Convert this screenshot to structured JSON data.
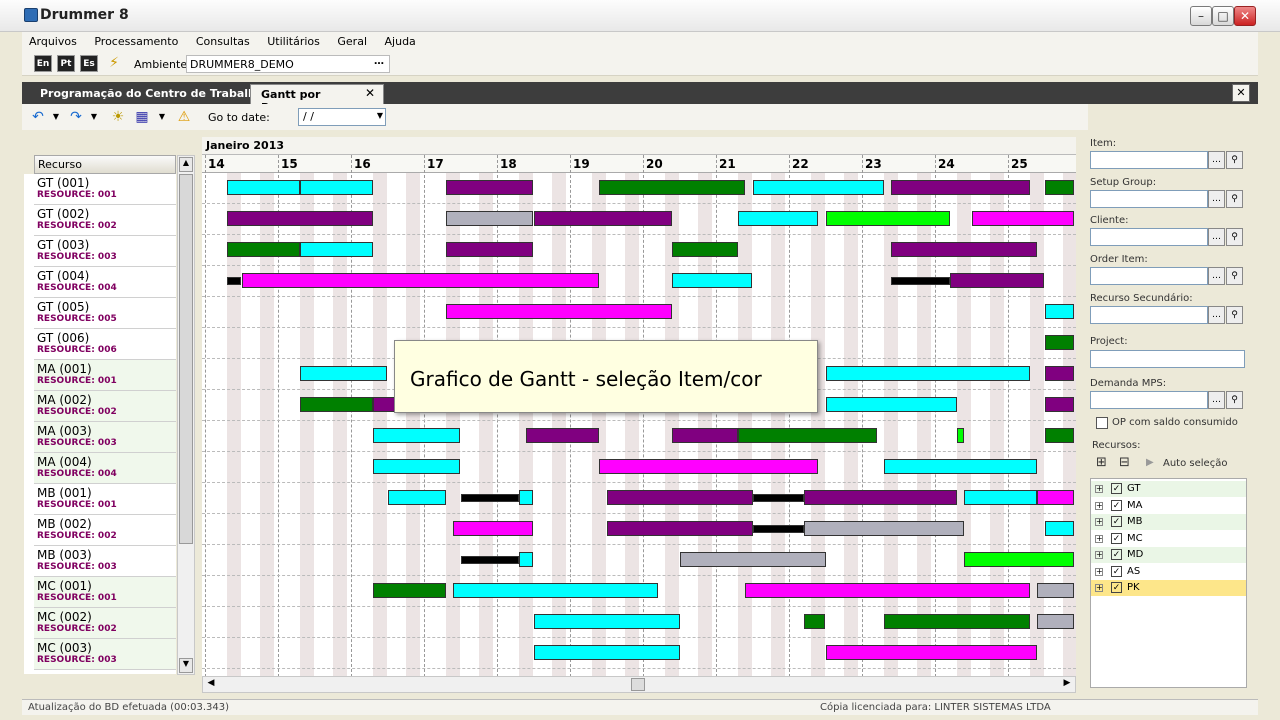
{
  "window": {
    "title": "Drummer 8"
  },
  "menu": [
    "Arquivos",
    "Processamento",
    "Consultas",
    "Utilitários",
    "Geral",
    "Ajuda"
  ],
  "toolbar": {
    "lang": [
      "En",
      "Pt",
      "Es"
    ],
    "ambiente_label": "Ambiente:",
    "ambiente_value": "DRUMMER8_DEMO"
  },
  "tabs": [
    {
      "label": "Programação do Centro de Trabalho"
    },
    {
      "label": "Gantt por Recurso"
    }
  ],
  "gantt_toolbar": {
    "goto_label": "Go to date:",
    "goto_value": "/ /"
  },
  "resources_header": "Recurso",
  "resources": [
    {
      "name": "GT (001)",
      "sub": "RESOURCE: 001"
    },
    {
      "name": "GT (002)",
      "sub": "RESOURCE: 002"
    },
    {
      "name": "GT (003)",
      "sub": "RESOURCE: 003"
    },
    {
      "name": "GT (004)",
      "sub": "RESOURCE: 004"
    },
    {
      "name": "GT (005)",
      "sub": "RESOURCE: 005"
    },
    {
      "name": "GT (006)",
      "sub": "RESOURCE: 006"
    },
    {
      "name": "MA (001)",
      "sub": "RESOURCE: 001"
    },
    {
      "name": "MA (002)",
      "sub": "RESOURCE: 002"
    },
    {
      "name": "MA (003)",
      "sub": "RESOURCE: 003"
    },
    {
      "name": "MA (004)",
      "sub": "RESOURCE: 004"
    },
    {
      "name": "MB (001)",
      "sub": "RESOURCE: 001"
    },
    {
      "name": "MB (002)",
      "sub": "RESOURCE: 002"
    },
    {
      "name": "MB (003)",
      "sub": "RESOURCE: 003"
    },
    {
      "name": "MC (001)",
      "sub": "RESOURCE: 001"
    },
    {
      "name": "MC (002)",
      "sub": "RESOURCE: 002"
    },
    {
      "name": "MC (003)",
      "sub": "RESOURCE: 003"
    }
  ],
  "gantt": {
    "month": "Janeiro 2013",
    "days": [
      "14",
      "15",
      "16",
      "17",
      "18",
      "19",
      "20",
      "21",
      "22",
      "23",
      "24",
      "25"
    ]
  },
  "colors": {
    "cyan": "#00ffff",
    "purple": "#800080",
    "green": "#008000",
    "magenta": "#ff00ff",
    "gray": "#b0b0bc",
    "lime": "#00ff00",
    "black": "#000000"
  },
  "tasks": [
    [
      [
        14.3,
        15.3,
        "cyan"
      ],
      [
        15.3,
        16.3,
        "cyan"
      ],
      [
        17.3,
        18.5,
        "purple"
      ],
      [
        19.4,
        21.4,
        "green"
      ],
      [
        21.5,
        23.3,
        "cyan"
      ],
      [
        23.4,
        25.3,
        "purple"
      ],
      [
        25.5,
        26,
        "green"
      ]
    ],
    [
      [
        14.3,
        16.3,
        "purple"
      ],
      [
        17.3,
        18.5,
        "gray"
      ],
      [
        18.5,
        20.4,
        "purple"
      ],
      [
        21.3,
        22.4,
        "cyan"
      ],
      [
        22.5,
        24.2,
        "lime"
      ],
      [
        24.5,
        26,
        "magenta"
      ]
    ],
    [
      [
        14.3,
        15.3,
        "green"
      ],
      [
        15.3,
        16.3,
        "cyan"
      ],
      [
        17.3,
        18.5,
        "purple"
      ],
      [
        20.4,
        21.3,
        "green"
      ],
      [
        23.4,
        25.4,
        "purple"
      ]
    ],
    [
      [
        14.3,
        14.5,
        "black"
      ],
      [
        14.5,
        19.4,
        "magenta"
      ],
      [
        20.4,
        21.5,
        "cyan"
      ],
      [
        23.4,
        24.2,
        "black"
      ],
      [
        24.2,
        25.5,
        "purple"
      ]
    ],
    [
      [
        17.3,
        20.4,
        "magenta"
      ],
      [
        25.5,
        26,
        "cyan"
      ]
    ],
    [
      [
        25.5,
        26,
        "green"
      ]
    ],
    [
      [
        15.3,
        16.5,
        "cyan"
      ],
      [
        22.5,
        25.3,
        "cyan"
      ],
      [
        25.5,
        26,
        "purple"
      ]
    ],
    [
      [
        15.3,
        16.3,
        "green"
      ],
      [
        16.3,
        17.3,
        "purple"
      ],
      [
        22.5,
        24.3,
        "cyan"
      ],
      [
        25.5,
        26,
        "purple"
      ]
    ],
    [
      [
        16.3,
        17.5,
        "cyan"
      ],
      [
        18.4,
        19.4,
        "purple"
      ],
      [
        20.4,
        21.3,
        "purple"
      ],
      [
        21.3,
        23.2,
        "green"
      ],
      [
        24.3,
        24.4,
        "lime"
      ],
      [
        25.5,
        26,
        "green"
      ]
    ],
    [
      [
        16.3,
        17.5,
        "cyan"
      ],
      [
        19.4,
        22.4,
        "magenta"
      ],
      [
        23.3,
        25.4,
        "cyan"
      ]
    ],
    [
      [
        16.5,
        17.3,
        "cyan"
      ],
      [
        17.5,
        18.3,
        "black"
      ],
      [
        18.3,
        18.5,
        "cyan"
      ],
      [
        19.5,
        21.5,
        "purple"
      ],
      [
        21.5,
        22.2,
        "black"
      ],
      [
        22.2,
        24.3,
        "purple"
      ],
      [
        24.4,
        25.4,
        "cyan"
      ],
      [
        25.4,
        26,
        "magenta"
      ]
    ],
    [
      [
        17.4,
        18.5,
        "magenta"
      ],
      [
        19.5,
        21.5,
        "purple"
      ],
      [
        21.5,
        22.2,
        "black"
      ],
      [
        22.2,
        24.4,
        "gray"
      ],
      [
        25.5,
        26,
        "cyan"
      ]
    ],
    [
      [
        17.5,
        18.3,
        "black"
      ],
      [
        18.3,
        18.5,
        "cyan"
      ],
      [
        20.5,
        22.5,
        "gray"
      ],
      [
        24.4,
        26,
        "lime"
      ]
    ],
    [
      [
        16.3,
        17.3,
        "green"
      ],
      [
        17.4,
        20.2,
        "cyan"
      ],
      [
        21.4,
        25.3,
        "magenta"
      ],
      [
        25.4,
        26,
        "gray"
      ]
    ],
    [
      [
        18.5,
        20.5,
        "cyan"
      ],
      [
        22.2,
        22.5,
        "green"
      ],
      [
        23.3,
        25.3,
        "green"
      ],
      [
        25.4,
        26,
        "gray"
      ]
    ],
    [
      [
        18.5,
        20.5,
        "cyan"
      ],
      [
        22.5,
        25.4,
        "magenta"
      ]
    ]
  ],
  "tooltip": "Grafico de Gantt - seleção Item/cor",
  "filters": [
    {
      "label": "Item:",
      "type": "lookup"
    },
    {
      "label": "Setup Group:",
      "type": "lookup"
    },
    {
      "label": "Cliente:",
      "type": "lookup"
    },
    {
      "label": "Order Item:",
      "type": "lookup"
    },
    {
      "label": "Recurso Secundário:",
      "type": "lookup"
    },
    {
      "label": "Project:",
      "type": "text"
    },
    {
      "label": "Demanda MPS:",
      "type": "lookup"
    }
  ],
  "op_checkbox": "OP com saldo consumido",
  "recursos_label": "Recursos:",
  "auto_selecao": "Auto seleção",
  "tree": [
    {
      "label": "GT"
    },
    {
      "label": "MA"
    },
    {
      "label": "MB"
    },
    {
      "label": "MC"
    },
    {
      "label": "MD"
    },
    {
      "label": "AS"
    },
    {
      "label": "PK",
      "selected": true
    }
  ],
  "status": {
    "left": "Atualização do BD efetuada (00:03.343)",
    "right": "Cópia licenciada para: LINTER SISTEMAS LTDA"
  }
}
